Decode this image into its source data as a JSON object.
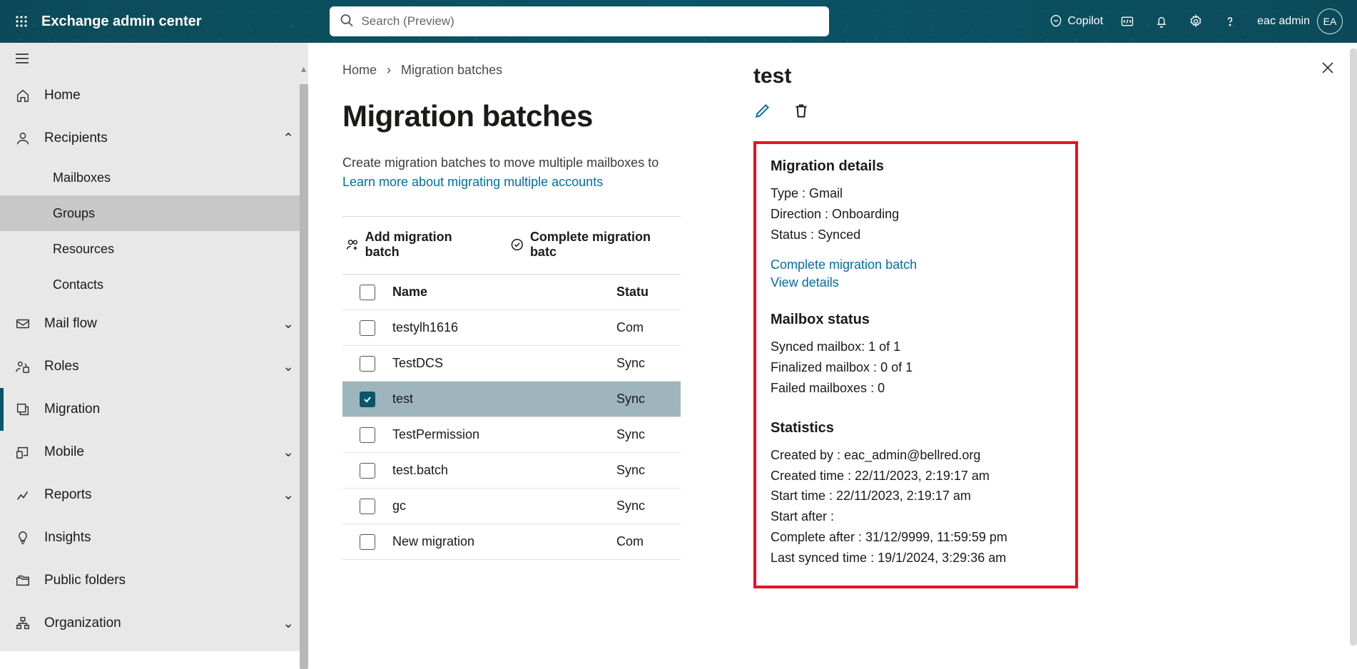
{
  "header": {
    "app_title": "Exchange admin center",
    "search_placeholder": "Search (Preview)",
    "copilot_label": "Copilot",
    "user_name": "eac admin",
    "user_initials": "EA"
  },
  "sidebar": {
    "items": [
      {
        "icon": "home",
        "label": "Home",
        "expand": false
      },
      {
        "icon": "person",
        "label": "Recipients",
        "expand": true,
        "open": true,
        "subs": [
          {
            "label": "Mailboxes"
          },
          {
            "label": "Groups",
            "active": true
          },
          {
            "label": "Resources"
          },
          {
            "label": "Contacts"
          }
        ]
      },
      {
        "icon": "mail",
        "label": "Mail flow",
        "expand": true
      },
      {
        "icon": "roles",
        "label": "Roles",
        "expand": true
      },
      {
        "icon": "migrate",
        "label": "Migration",
        "expand": false,
        "selected": true
      },
      {
        "icon": "mobile",
        "label": "Mobile",
        "expand": true
      },
      {
        "icon": "reports",
        "label": "Reports",
        "expand": true
      },
      {
        "icon": "bulb",
        "label": "Insights",
        "expand": false
      },
      {
        "icon": "folders",
        "label": "Public folders",
        "expand": false
      },
      {
        "icon": "org",
        "label": "Organization",
        "expand": true
      }
    ]
  },
  "breadcrumb": {
    "home": "Home",
    "current": "Migration batches"
  },
  "page": {
    "title": "Migration batches",
    "subtitle_pre": "Create migration batches to move multiple mailboxes to ",
    "learn_link": "Learn more about migrating multiple accounts"
  },
  "toolbar": {
    "add": "Add migration batch",
    "complete": "Complete migration batc"
  },
  "table": {
    "columns": {
      "name": "Name",
      "status": "Statu"
    },
    "rows": [
      {
        "name": "testylh1616",
        "status": "Com"
      },
      {
        "name": "TestDCS",
        "status": "Sync"
      },
      {
        "name": "test",
        "status": "Sync",
        "selected": true
      },
      {
        "name": "TestPermission",
        "status": "Sync"
      },
      {
        "name": "test.batch",
        "status": "Sync"
      },
      {
        "name": "gc",
        "status": "Sync"
      },
      {
        "name": "New migration",
        "status": "Com"
      }
    ]
  },
  "panel": {
    "title": "test",
    "sections": {
      "migration": {
        "heading": "Migration details",
        "type_label": "Type : ",
        "type_val": "Gmail",
        "direction_label": "Direction : ",
        "direction_val": "Onboarding",
        "status_label": "Status : ",
        "status_val": "Synced",
        "link_complete": "Complete migration batch",
        "link_details": "View details"
      },
      "mailbox": {
        "heading": "Mailbox status",
        "synced": "Synced mailbox: 1 of 1",
        "finalized": "Finalized mailbox : 0 of 1",
        "failed": "Failed mailboxes : 0"
      },
      "stats": {
        "heading": "Statistics",
        "created_by": "Created by : eac_admin@bellred.org",
        "created_time": "Created time : 22/11/2023, 2:19:17 am",
        "start_time": "Start time : 22/11/2023, 2:19:17 am",
        "start_after": "Start after :",
        "complete_after": "Complete after : 31/12/9999, 11:59:59 pm",
        "last_synced": "Last synced time : 19/1/2024, 3:29:36 am"
      }
    }
  }
}
